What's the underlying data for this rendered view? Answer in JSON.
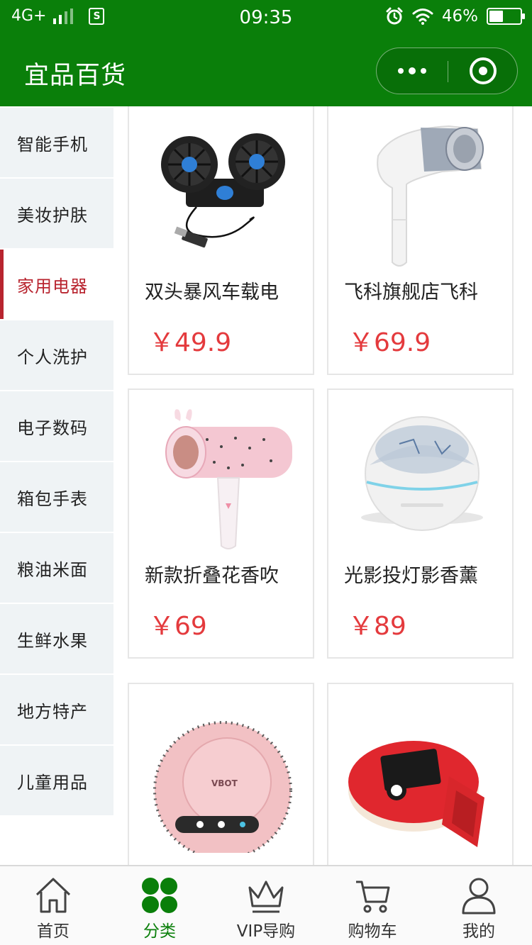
{
  "status_bar": {
    "network": "4G+",
    "sim_label": "S",
    "time": "09:35",
    "battery": "46%",
    "battery_level": 0.46
  },
  "nav": {
    "title": "宜品百货"
  },
  "categories": [
    {
      "label": "智能手机",
      "active": false
    },
    {
      "label": "美妆护肤",
      "active": false
    },
    {
      "label": "家用电器",
      "active": true
    },
    {
      "label": "个人洗护",
      "active": false
    },
    {
      "label": "电子数码",
      "active": false
    },
    {
      "label": "箱包手表",
      "active": false
    },
    {
      "label": "粮油米面",
      "active": false
    },
    {
      "label": "生鲜水果",
      "active": false
    },
    {
      "label": "地方特产",
      "active": false
    },
    {
      "label": "儿童用品",
      "active": false
    }
  ],
  "products": [
    {
      "name": "双头暴风车载电",
      "price": "￥49.9",
      "image": "car-fan-image"
    },
    {
      "name": "飞科旗舰店飞科",
      "price": "￥69.9",
      "image": "hair-dryer-image"
    },
    {
      "name": "新款折叠花香吹",
      "price": "￥69",
      "image": "pink-hair-dryer-image"
    },
    {
      "name": "光影投灯影香薰",
      "price": "￥89",
      "image": "aroma-diffuser-image"
    },
    {
      "name": "",
      "price": "",
      "image": "robot-vacuum-image"
    },
    {
      "name": "",
      "price": "",
      "image": "red-device-image"
    }
  ],
  "product_image_text": {
    "vacuum_brand": "VBOT"
  },
  "tabbar": [
    {
      "label": "首页",
      "icon": "home-icon",
      "active": false
    },
    {
      "label": "分类",
      "icon": "category-icon",
      "active": true
    },
    {
      "label": "VIP导购",
      "icon": "crown-icon",
      "active": false
    },
    {
      "label": "购物车",
      "icon": "cart-icon",
      "active": false
    },
    {
      "label": "我的",
      "icon": "user-icon",
      "active": false
    }
  ],
  "colors": {
    "primary": "#0a7f0a",
    "accent_red": "#b8242f",
    "price_red": "#e43a3d",
    "sidebar_bg": "#eff3f5"
  }
}
